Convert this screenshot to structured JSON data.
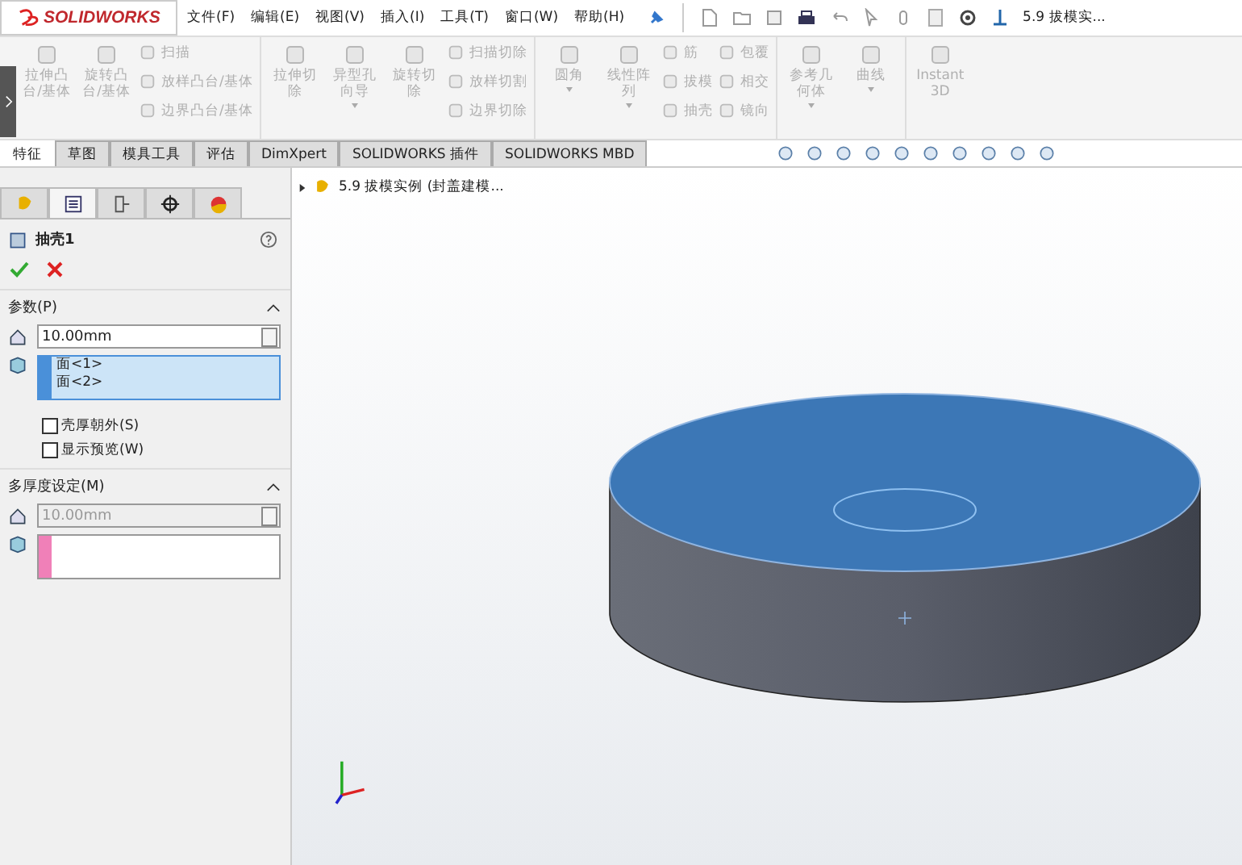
{
  "app": {
    "logo": "SOLIDWORKS",
    "menu": [
      "文件(F)",
      "编辑(E)",
      "视图(V)",
      "插入(I)",
      "工具(T)",
      "窗口(W)",
      "帮助(H)"
    ],
    "doc_title": "5.9 拔模实..."
  },
  "ribbon": {
    "groups": [
      {
        "items": [
          {
            "kind": "large",
            "label": "拉伸凸台/基体",
            "disabled": true,
            "dropdown": false
          },
          {
            "kind": "large",
            "label": "旋转凸台/基体",
            "disabled": true,
            "dropdown": false
          },
          {
            "kind": "stack",
            "labels": [
              "扫描",
              "放样凸台/基体",
              "边界凸台/基体"
            ],
            "disabled": true
          }
        ]
      },
      {
        "items": [
          {
            "kind": "large",
            "label": "拉伸切除",
            "disabled": true,
            "dropdown": false
          },
          {
            "kind": "large",
            "label": "异型孔向导",
            "disabled": true,
            "dropdown": true
          },
          {
            "kind": "large",
            "label": "旋转切除",
            "disabled": true,
            "dropdown": false
          },
          {
            "kind": "stack",
            "labels": [
              "扫描切除",
              "放样切割",
              "边界切除"
            ],
            "disabled": true
          }
        ]
      },
      {
        "items": [
          {
            "kind": "large",
            "label": "圆角",
            "disabled": true,
            "dropdown": true
          },
          {
            "kind": "large",
            "label": "线性阵列",
            "disabled": true,
            "dropdown": true
          },
          {
            "kind": "stack",
            "labels": [
              "筋",
              "拔模",
              "抽壳"
            ],
            "disabled": true
          },
          {
            "kind": "stack",
            "labels": [
              "包覆",
              "相交",
              "镜向"
            ],
            "disabled": true
          }
        ]
      },
      {
        "items": [
          {
            "kind": "large",
            "label": "参考几何体",
            "disabled": true,
            "dropdown": true
          },
          {
            "kind": "large",
            "label": "曲线",
            "disabled": true,
            "dropdown": true
          }
        ]
      },
      {
        "items": [
          {
            "kind": "large",
            "label": "Instant3D",
            "disabled": true,
            "dropdown": false
          }
        ]
      }
    ]
  },
  "tabs": [
    {
      "label": "特征",
      "selected": true
    },
    {
      "label": "草图",
      "selected": false
    },
    {
      "label": "模具工具",
      "selected": false
    },
    {
      "label": "评估",
      "selected": false
    },
    {
      "label": "DimXpert",
      "selected": false
    },
    {
      "label": "SOLIDWORKS 插件",
      "selected": false
    },
    {
      "label": "SOLIDWORKS MBD",
      "selected": false
    }
  ],
  "panel": {
    "tabs": [
      {
        "selected": false
      },
      {
        "selected": true
      },
      {
        "selected": false
      },
      {
        "selected": false
      },
      {
        "selected": false
      }
    ],
    "title": "抽壳1",
    "sections": [
      {
        "title": "参数(P)",
        "expanded": true,
        "thickness": "10.00mm",
        "thickness_disabled": false,
        "faces": [
          "面<1>",
          "面<2>"
        ],
        "color": "#4a90d9",
        "checkboxes": [
          {
            "label": "壳厚朝外(S)",
            "checked": false
          },
          {
            "label": "显示预览(W)",
            "checked": false
          }
        ]
      },
      {
        "title": "多厚度设定(M)",
        "expanded": true,
        "thickness": "10.00mm",
        "thickness_disabled": true,
        "color": "#f080b8"
      }
    ]
  },
  "tree": {
    "label": "5.9 拔模实例 (封盖建模..."
  }
}
